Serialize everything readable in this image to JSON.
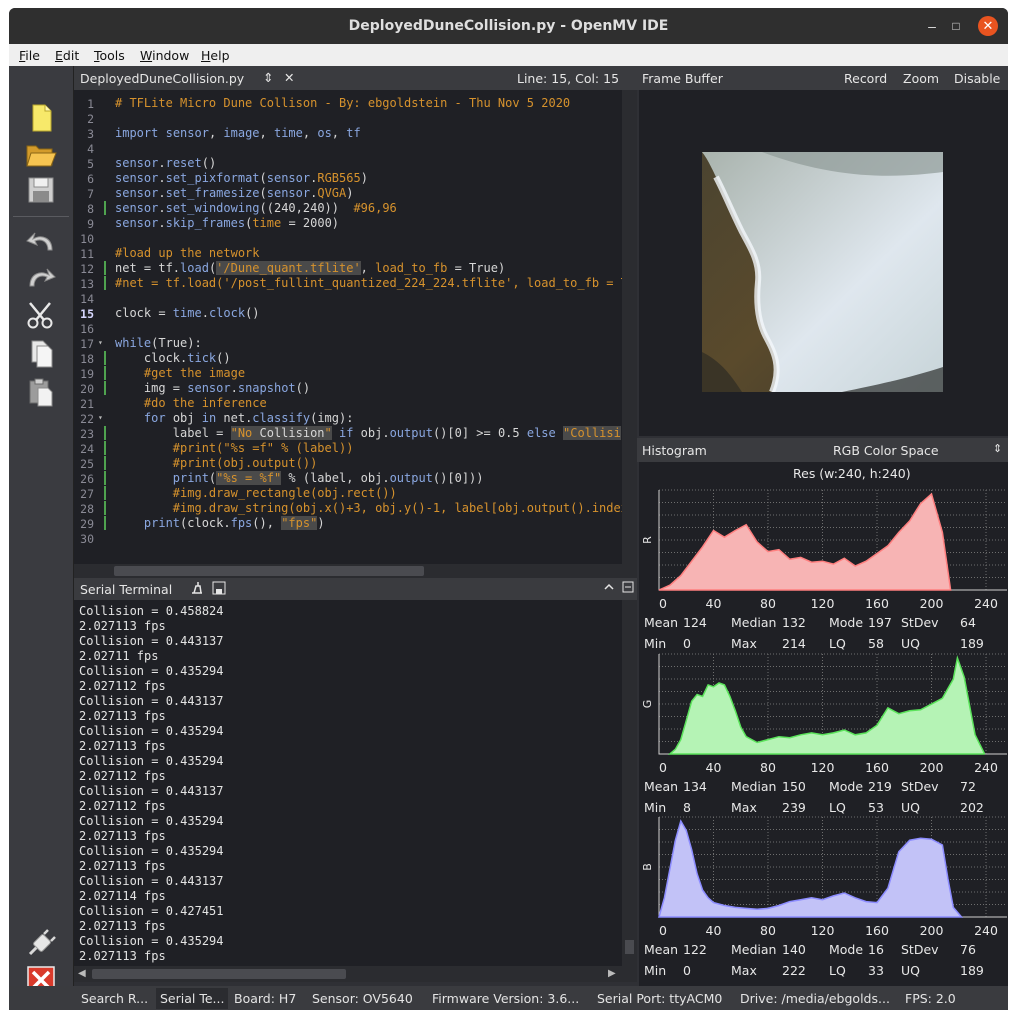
{
  "window": {
    "title": "DeployedDuneCollision.py - OpenMV IDE",
    "min_glyph": "–",
    "max_glyph": "□",
    "close_glyph": "✕"
  },
  "menu": [
    {
      "u": "F",
      "rest": "ile"
    },
    {
      "u": "E",
      "rest": "dit"
    },
    {
      "u": "T",
      "rest": "ools"
    },
    {
      "u": "W",
      "rest": "indow"
    },
    {
      "u": "H",
      "rest": "elp"
    }
  ],
  "toolbar": [
    "new-file-icon",
    "open-folder-icon",
    "save-icon",
    "undo-icon",
    "redo-icon",
    "cut-icon",
    "copy-icon",
    "paste-icon",
    "connect-icon",
    "stop-icon"
  ],
  "editor": {
    "filename": "DeployedDuneCollision.py",
    "dropdown_glyph": "⇕",
    "close_glyph": "✕",
    "cursor_pos": "Line: 15, Col: 15",
    "current_line": 15,
    "changed_lines": [
      8,
      12,
      13,
      18,
      19,
      20,
      23,
      24,
      25,
      26,
      27,
      28,
      29
    ],
    "fold_lines": [
      17,
      22
    ],
    "lines": [
      [
        [
          "c-com",
          "# TFLite Micro Dune Collison - By: ebgoldstein - Thu Nov 5 2020"
        ]
      ],
      [],
      [
        [
          "c-kw",
          "import"
        ],
        [
          "",
          " "
        ],
        [
          "c-fn",
          "sensor"
        ],
        [
          "",
          ", "
        ],
        [
          "c-fn",
          "image"
        ],
        [
          "",
          ", "
        ],
        [
          "c-fn",
          "time"
        ],
        [
          "",
          ", "
        ],
        [
          "c-fn",
          "os"
        ],
        [
          "",
          ", "
        ],
        [
          "c-fn",
          "tf"
        ]
      ],
      [],
      [
        [
          "c-fn",
          "sensor"
        ],
        [
          "",
          "."
        ],
        [
          "c-fn",
          "reset"
        ],
        [
          "",
          "()"
        ]
      ],
      [
        [
          "c-fn",
          "sensor"
        ],
        [
          "",
          "."
        ],
        [
          "c-fn",
          "set_pixformat"
        ],
        [
          "",
          "("
        ],
        [
          "c-fn",
          "sensor"
        ],
        [
          "",
          "."
        ],
        [
          "c-arg",
          "RGB565"
        ],
        [
          "",
          ")"
        ]
      ],
      [
        [
          "c-fn",
          "sensor"
        ],
        [
          "",
          "."
        ],
        [
          "c-fn",
          "set_framesize"
        ],
        [
          "",
          "("
        ],
        [
          "c-fn",
          "sensor"
        ],
        [
          "",
          "."
        ],
        [
          "c-arg",
          "QVGA"
        ],
        [
          "",
          ")"
        ]
      ],
      [
        [
          "c-fn",
          "sensor"
        ],
        [
          "",
          "."
        ],
        [
          "c-fn",
          "set_windowing"
        ],
        [
          "",
          "((240,240))  "
        ],
        [
          "c-com",
          "#96,96"
        ]
      ],
      [
        [
          "c-fn",
          "sensor"
        ],
        [
          "",
          "."
        ],
        [
          "c-fn",
          "skip_frames"
        ],
        [
          "",
          "("
        ],
        [
          "c-arg",
          "time"
        ],
        [
          "",
          " = 2000)"
        ]
      ],
      [],
      [
        [
          "c-com",
          "#load up the network"
        ]
      ],
      [
        [
          "",
          "net = tf."
        ],
        [
          "c-fn",
          "load"
        ],
        [
          "",
          "("
        ],
        [
          "c-str c-hl",
          "'/Dune_quant.tflite'"
        ],
        [
          "",
          ", "
        ],
        [
          "c-arg",
          "load_to_fb"
        ],
        [
          "",
          " = True)"
        ]
      ],
      [
        [
          "c-com",
          "#net = tf.load('/post_fullint_quantized_224_224.tflite', load_to_fb = T"
        ]
      ],
      [],
      [
        [
          "",
          "clock = "
        ],
        [
          "c-fn",
          "time"
        ],
        [
          "",
          "."
        ],
        [
          "c-fn",
          "clock"
        ],
        [
          "",
          "()"
        ]
      ],
      [],
      [
        [
          "c-kw",
          "while"
        ],
        [
          "",
          "(True):"
        ]
      ],
      [
        [
          "",
          "    clock."
        ],
        [
          "c-fn",
          "tick"
        ],
        [
          "",
          "()"
        ]
      ],
      [
        [
          "",
          "    "
        ],
        [
          "c-com",
          "#get the image"
        ]
      ],
      [
        [
          "",
          "    img = "
        ],
        [
          "c-fn",
          "sensor"
        ],
        [
          "",
          "."
        ],
        [
          "c-fn",
          "snapshot"
        ],
        [
          "",
          "()"
        ]
      ],
      [
        [
          "",
          "    "
        ],
        [
          "c-com",
          "#do the inference"
        ]
      ],
      [
        [
          "",
          "    "
        ],
        [
          "c-kw",
          "for"
        ],
        [
          "",
          " obj "
        ],
        [
          "c-kw",
          "in"
        ],
        [
          "",
          " net."
        ],
        [
          "c-fn",
          "classify"
        ],
        [
          "",
          "(img):"
        ]
      ],
      [
        [
          "",
          "        label = "
        ],
        [
          "c-str c-hl",
          "\"No "
        ],
        [
          "c-hl",
          "Collision"
        ],
        [
          "c-str c-hl",
          "\""
        ],
        [
          "",
          " "
        ],
        [
          "c-kw",
          "if"
        ],
        [
          "",
          " obj."
        ],
        [
          "c-fn",
          "output"
        ],
        [
          "",
          "()[0] >= 0.5 "
        ],
        [
          "c-kw",
          "else"
        ],
        [
          "",
          " "
        ],
        [
          "c-str c-hl",
          "\"Collisi"
        ]
      ],
      [
        [
          "",
          "        "
        ],
        [
          "c-com",
          "#print(\"%s =f\" % (label))"
        ]
      ],
      [
        [
          "",
          "        "
        ],
        [
          "c-com",
          "#print(obj.output())"
        ]
      ],
      [
        [
          "",
          "        "
        ],
        [
          "c-fn",
          "print"
        ],
        [
          "",
          "("
        ],
        [
          "c-str c-hl",
          "\"%s = %f\""
        ],
        [
          "",
          " % (label, obj."
        ],
        [
          "c-fn",
          "output"
        ],
        [
          "",
          "()[0]))"
        ]
      ],
      [
        [
          "",
          "        "
        ],
        [
          "c-com",
          "#img.draw_rectangle(obj.rect())"
        ]
      ],
      [
        [
          "",
          "        "
        ],
        [
          "c-com",
          "#img.draw_string(obj.x()+3, obj.y()-1, label[obj.output().index"
        ]
      ],
      [
        [
          "",
          "    "
        ],
        [
          "c-fn",
          "print"
        ],
        [
          "",
          "(clock."
        ],
        [
          "c-fn",
          "fps"
        ],
        [
          "",
          "(), "
        ],
        [
          "c-str c-hl",
          "\"fps\""
        ],
        [
          "",
          ")"
        ]
      ],
      []
    ]
  },
  "serial": {
    "title": "Serial Terminal",
    "lines": [
      "Collision = 0.458824",
      "2.027113 fps",
      "Collision = 0.443137",
      "2.02711 fps",
      "Collision = 0.435294",
      "2.027112 fps",
      "Collision = 0.443137",
      "2.027113 fps",
      "Collision = 0.435294",
      "2.027113 fps",
      "Collision = 0.435294",
      "2.027112 fps",
      "Collision = 0.443137",
      "2.027112 fps",
      "Collision = 0.435294",
      "2.027113 fps",
      "Collision = 0.435294",
      "2.027113 fps",
      "Collision = 0.443137",
      "2.027114 fps",
      "Collision = 0.427451",
      "2.027113 fps",
      "Collision = 0.435294",
      "2.027113 fps"
    ]
  },
  "frame_buffer": {
    "title": "Frame Buffer",
    "record": "Record",
    "zoom": "Zoom",
    "disable": "Disable"
  },
  "histogram": {
    "title": "Histogram",
    "color_space": "RGB Color Space",
    "resolution": "Res (w:240, h:240)",
    "ticks": [
      "0",
      "40",
      "80",
      "120",
      "160",
      "200",
      "240"
    ],
    "stat_labels": {
      "mean": "Mean",
      "median": "Median",
      "mode": "Mode",
      "stdev": "StDev",
      "min": "Min",
      "max": "Max",
      "lq": "LQ",
      "uq": "UQ"
    },
    "channels": [
      {
        "name": "R",
        "fill": "#f7b4b4",
        "stroke": "#ff7f7f",
        "mean": "124",
        "median": "132",
        "mode": "197",
        "stdev": "64",
        "min": "0",
        "max": "214",
        "lq": "58",
        "uq": "189",
        "x": [
          0,
          8,
          16,
          24,
          32,
          40,
          48,
          56,
          64,
          72,
          80,
          88,
          96,
          104,
          112,
          120,
          128,
          136,
          144,
          152,
          160,
          168,
          176,
          184,
          192,
          200,
          208,
          214
        ],
        "y": [
          0,
          0.05,
          0.15,
          0.3,
          0.45,
          0.62,
          0.55,
          0.62,
          0.68,
          0.5,
          0.4,
          0.42,
          0.32,
          0.34,
          0.29,
          0.3,
          0.27,
          0.33,
          0.25,
          0.3,
          0.38,
          0.46,
          0.6,
          0.72,
          0.9,
          1.0,
          0.6,
          0.0
        ]
      },
      {
        "name": "G",
        "fill": "#b5f3b5",
        "stroke": "#5be35b",
        "mean": "134",
        "median": "150",
        "mode": "219",
        "stdev": "72",
        "min": "8",
        "max": "239",
        "lq": "53",
        "uq": "202",
        "x": [
          8,
          12,
          16,
          20,
          24,
          28,
          32,
          36,
          40,
          44,
          48,
          52,
          56,
          60,
          64,
          72,
          80,
          88,
          96,
          104,
          112,
          120,
          128,
          136,
          144,
          152,
          160,
          168,
          176,
          184,
          192,
          200,
          208,
          216,
          219,
          224,
          232,
          239
        ],
        "y": [
          0.0,
          0.05,
          0.15,
          0.35,
          0.55,
          0.62,
          0.6,
          0.72,
          0.7,
          0.74,
          0.72,
          0.6,
          0.45,
          0.28,
          0.18,
          0.12,
          0.15,
          0.18,
          0.17,
          0.2,
          0.22,
          0.2,
          0.22,
          0.25,
          0.2,
          0.22,
          0.3,
          0.48,
          0.42,
          0.45,
          0.46,
          0.52,
          0.58,
          0.78,
          1.0,
          0.8,
          0.2,
          0.0
        ]
      },
      {
        "name": "B",
        "fill": "#c2c2f7",
        "stroke": "#8c8cff",
        "mean": "122",
        "median": "140",
        "mode": "16",
        "stdev": "76",
        "min": "0",
        "max": "222",
        "lq": "33",
        "uq": "189",
        "x": [
          0,
          4,
          8,
          12,
          16,
          20,
          24,
          28,
          32,
          36,
          40,
          48,
          56,
          64,
          72,
          80,
          88,
          96,
          104,
          112,
          120,
          128,
          136,
          144,
          152,
          160,
          168,
          176,
          184,
          192,
          200,
          208,
          212,
          216,
          222
        ],
        "y": [
          0,
          0.2,
          0.5,
          0.8,
          1.0,
          0.9,
          0.7,
          0.45,
          0.28,
          0.2,
          0.15,
          0.12,
          0.1,
          0.09,
          0.08,
          0.09,
          0.12,
          0.16,
          0.18,
          0.2,
          0.18,
          0.22,
          0.25,
          0.2,
          0.16,
          0.15,
          0.3,
          0.68,
          0.8,
          0.82,
          0.81,
          0.75,
          0.4,
          0.1,
          0.0
        ]
      }
    ]
  },
  "status": {
    "search": "Search R...",
    "serial": "Serial Te...",
    "board": "Board: H7",
    "sensor": "Sensor: OV5640",
    "firmware": "Firmware Version: 3.6...",
    "port": "Serial Port: ttyACM0",
    "drive": "Drive: /media/ebgolds...",
    "fps": "FPS:  2.0"
  }
}
